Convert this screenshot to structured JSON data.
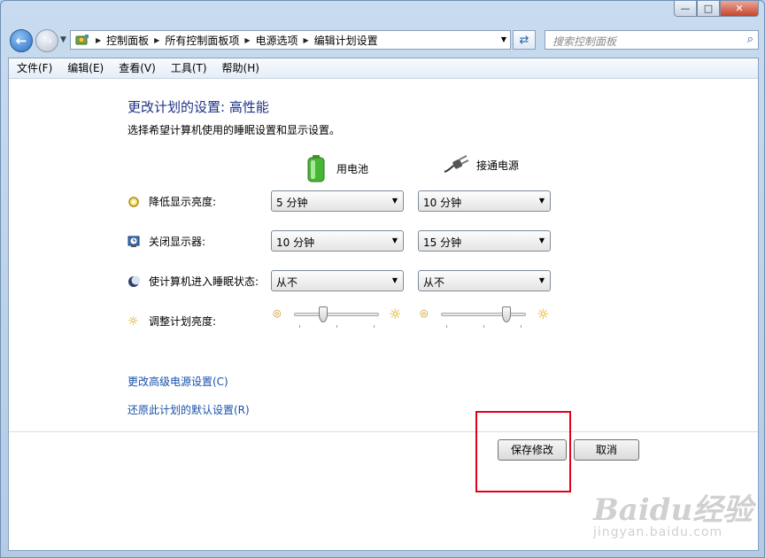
{
  "window": {
    "caption": {
      "minimize": "—",
      "maximize": "□",
      "close": "✕"
    }
  },
  "nav": {
    "breadcrumbs": [
      "控制面板",
      "所有控制面板项",
      "电源选项",
      "编辑计划设置"
    ],
    "search_placeholder": "搜索控制面板"
  },
  "menu": [
    "文件(F)",
    "编辑(E)",
    "查看(V)",
    "工具(T)",
    "帮助(H)"
  ],
  "main": {
    "title": "更改计划的设置: 高性能",
    "subtitle": "选择希望计算机使用的睡眠设置和显示设置。",
    "columns": [
      "用电池",
      "接通电源"
    ],
    "rows": [
      {
        "label": "降低显示亮度:",
        "battery": "5 分钟",
        "plugged": "10 分钟"
      },
      {
        "label": "关闭显示器:",
        "battery": "10 分钟",
        "plugged": "15 分钟"
      },
      {
        "label": "使计算机进入睡眠状态:",
        "battery": "从不",
        "plugged": "从不"
      }
    ],
    "brightness": {
      "label": "调整计划亮度:",
      "battery_level": 0.33,
      "plugged_level": 0.8
    },
    "links": [
      "更改高级电源设置(C)",
      "还原此计划的默认设置(R)"
    ],
    "buttons": {
      "save": "保存修改",
      "cancel": "取消"
    }
  },
  "watermark": {
    "brand": "Baidu经验",
    "url": "jingyan.baidu.com"
  },
  "colors": {
    "link": "#1750ab",
    "title": "#1e3287",
    "highlight": "#e3001b"
  }
}
